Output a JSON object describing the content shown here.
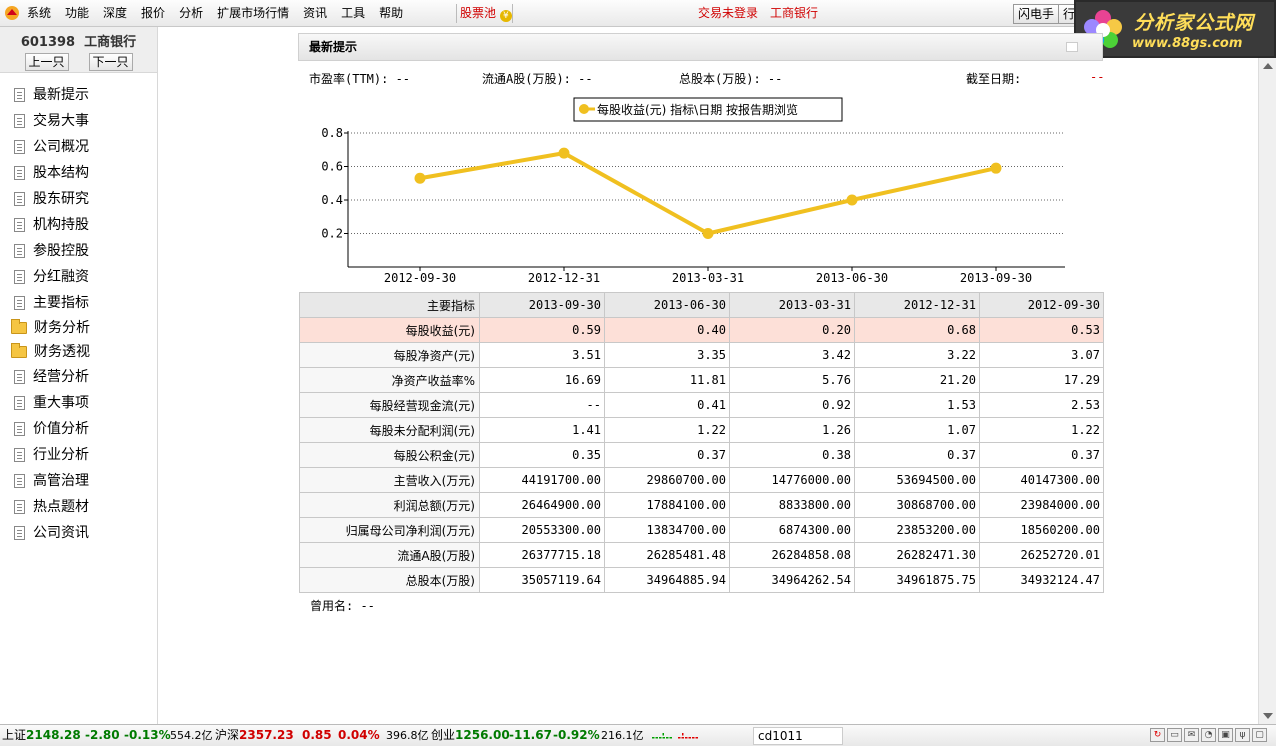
{
  "menu": {
    "items": [
      "系统",
      "功能",
      "深度",
      "报价",
      "分析",
      "扩展市场行情",
      "资讯",
      "工具",
      "帮助"
    ],
    "stock_pool": "股票池",
    "not_logged_in": "交易未登录",
    "broker": "工商银行",
    "flash_btn": "闪电手",
    "quote_btn": "行"
  },
  "brand": {
    "line1": "分析家公式网",
    "line2": "www.88gs.com"
  },
  "sidebar": {
    "stock_code": "601398",
    "stock_name": "工商银行",
    "prev_label": "上一只",
    "next_label": "下一只",
    "items": [
      {
        "label": "最新提示",
        "type": "doc"
      },
      {
        "label": "交易大事",
        "type": "doc"
      },
      {
        "label": "公司概况",
        "type": "doc"
      },
      {
        "label": "股本结构",
        "type": "doc"
      },
      {
        "label": "股东研究",
        "type": "doc"
      },
      {
        "label": "机构持股",
        "type": "doc"
      },
      {
        "label": "参股控股",
        "type": "doc"
      },
      {
        "label": "分红融资",
        "type": "doc"
      },
      {
        "label": "主要指标",
        "type": "doc"
      },
      {
        "label": "财务分析",
        "type": "folder"
      },
      {
        "label": "财务透视",
        "type": "folder"
      },
      {
        "label": "经营分析",
        "type": "doc"
      },
      {
        "label": "重大事项",
        "type": "doc"
      },
      {
        "label": "价值分析",
        "type": "doc"
      },
      {
        "label": "行业分析",
        "type": "doc"
      },
      {
        "label": "高管治理",
        "type": "doc"
      },
      {
        "label": "热点题材",
        "type": "doc"
      },
      {
        "label": "公司资讯",
        "type": "doc"
      }
    ]
  },
  "section": {
    "title": "最新提示",
    "pe_label": "市盈率(TTM): --",
    "float_label": "流通A股(万股): --",
    "total_label": "总股本(万股): --",
    "asof_label": "截至日期:",
    "asof_value": "--"
  },
  "chart_data": {
    "type": "line",
    "legend": "每股收益(元)  指标\\日期  按报告期浏览",
    "x": [
      "2012-09-30",
      "2012-12-31",
      "2013-03-31",
      "2013-06-30",
      "2013-09-30"
    ],
    "series": [
      {
        "name": "每股收益(元)",
        "values": [
          0.53,
          0.68,
          0.2,
          0.4,
          0.59
        ]
      }
    ],
    "yticks": [
      "0.2",
      "0.4",
      "0.6",
      "0.8"
    ],
    "ylim": [
      0.0,
      0.8
    ],
    "grid": true,
    "color": "#f0c020"
  },
  "table": {
    "headers": [
      "主要指标",
      "2013-09-30",
      "2013-06-30",
      "2013-03-31",
      "2012-12-31",
      "2012-09-30"
    ],
    "rows": [
      [
        "每股收益(元)",
        "0.59",
        "0.40",
        "0.20",
        "0.68",
        "0.53"
      ],
      [
        "每股净资产(元)",
        "3.51",
        "3.35",
        "3.42",
        "3.22",
        "3.07"
      ],
      [
        "净资产收益率%",
        "16.69",
        "11.81",
        "5.76",
        "21.20",
        "17.29"
      ],
      [
        "每股经营现金流(元)",
        "--",
        "0.41",
        "0.92",
        "1.53",
        "2.53"
      ],
      [
        "每股未分配利润(元)",
        "1.41",
        "1.22",
        "1.26",
        "1.07",
        "1.22"
      ],
      [
        "每股公积金(元)",
        "0.35",
        "0.37",
        "0.38",
        "0.37",
        "0.37"
      ],
      [
        "主营收入(万元)",
        "44191700.00",
        "29860700.00",
        "14776000.00",
        "53694500.00",
        "40147300.00"
      ],
      [
        "利润总额(万元)",
        "26464900.00",
        "17884100.00",
        "8833800.00",
        "30868700.00",
        "23984000.00"
      ],
      [
        "归属母公司净利润(万元)",
        "20553300.00",
        "13834700.00",
        "6874300.00",
        "23853200.00",
        "18560200.00"
      ],
      [
        "流通A股(万股)",
        "26377715.18",
        "26285481.48",
        "26284858.08",
        "26282471.30",
        "26252720.01"
      ],
      [
        "总股本(万股)",
        "35057119.64",
        "34964885.94",
        "34964262.54",
        "34961875.75",
        "34932124.47"
      ]
    ]
  },
  "former_name": "曾用名: --",
  "statusbar": {
    "sh_label": "上证",
    "sh_value": "2148.28",
    "sh_change": "-2.80",
    "sh_pct": "-0.13%",
    "sh_amount": "554.2亿",
    "hs_label": "沪深",
    "hs_value": "2357.23",
    "hs_change": "0.85",
    "hs_pct": "0.04%",
    "hs_amount": "396.8亿",
    "cy_label": "创业",
    "cy_value": "1256.00",
    "cy_change": "-11.67",
    "cy_pct": "-0.92%",
    "cy_amount": "216.1亿",
    "code": "cd1011"
  }
}
